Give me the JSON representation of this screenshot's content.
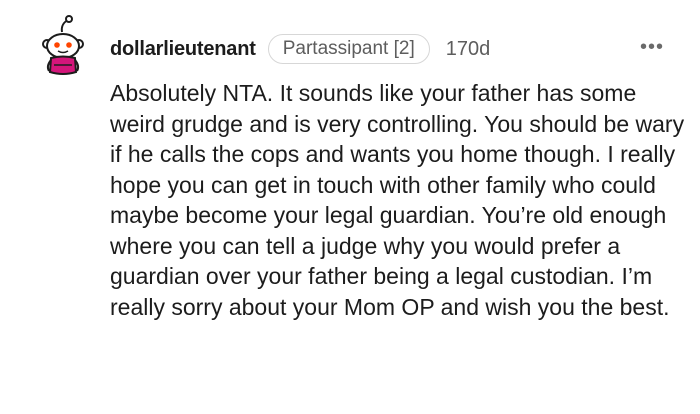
{
  "comment": {
    "author": "dollarlieutenant",
    "flair": "Partassipant [2]",
    "age": "170d",
    "more_glyph": "•••",
    "body": "Absolutely NTA. It sounds like your father has some weird grudge and is very controlling. You should be wary if he calls the cops and wants you home though. I really hope you can get in touch with other family who could maybe become your legal guardian. You’re old enough where you can tell a judge why you would prefer a guardian over your father being a legal custodian. I’m really sorry about your Mom OP and wish you the best."
  },
  "colors": {
    "text": "#1c1c1c",
    "meta": "#5d5d5d",
    "avatar_shirt": "#d4157a",
    "avatar_eye": "#ff4500"
  }
}
